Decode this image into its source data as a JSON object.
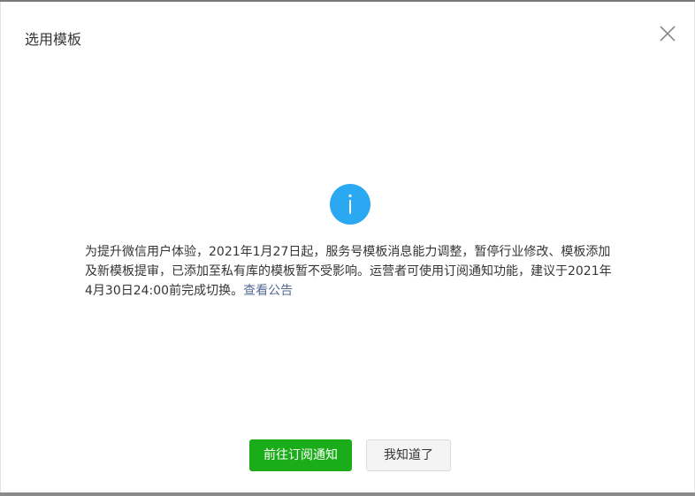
{
  "dialog": {
    "title": "选用模板",
    "close_icon": "close-icon",
    "info_icon": "info-icon",
    "info_icon_color": "#2aa8f2",
    "message_line1": "为提升微信用户体验，2021年1月27日起，服务号模板消息能力调整，暂停行业修改、模板添加",
    "message_line2": "及新模板提审，已添加至私有库的模板暂不受影响。运营者可使用订阅通知功能，建议于2021年",
    "message_line3": "4月30日24:00前完成切换。",
    "link_text": "查看公告",
    "link_color": "#576b95",
    "primary_button": "前往订阅通知",
    "primary_color": "#1aad19",
    "secondary_button": "我知道了"
  }
}
